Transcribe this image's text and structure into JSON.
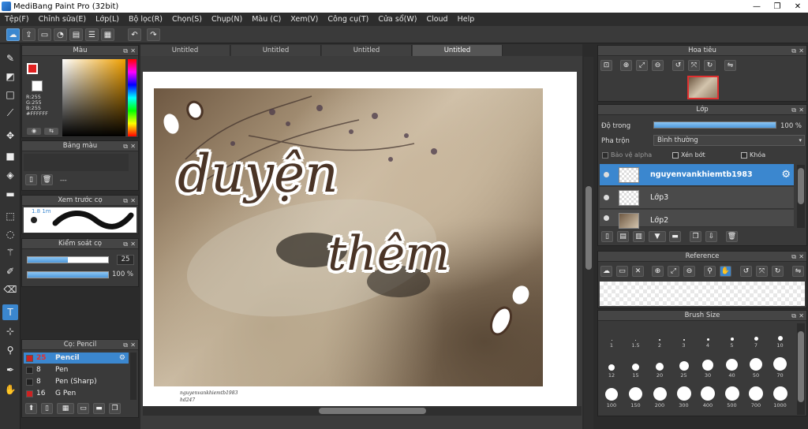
{
  "window": {
    "title": "MediBang Paint Pro (32bit)",
    "min": "—",
    "max": "❐",
    "close": "✕"
  },
  "menu": [
    "Tệp(F)",
    "Chỉnh sửa(E)",
    "Lớp(L)",
    "Bộ lọc(R)",
    "Chọn(S)",
    "Chụp(N)",
    "Màu (C)",
    "Xem(V)",
    "Công cụ(T)",
    "Cửa sổ(W)",
    "Cloud",
    "Help"
  ],
  "tabs": [
    "Untitled",
    "Untitled",
    "Untitled",
    "Untitled"
  ],
  "color_panel": {
    "title": "Màu",
    "r": "R:255",
    "g": "G:255",
    "b": "B:255",
    "hex": "#FFFFFF",
    "primary": "#e02020",
    "secondary": "#ffffff"
  },
  "palette_panel": {
    "title": "Bảng màu",
    "placeholder": "---"
  },
  "brush_preview": {
    "title": "Xem trước cọ",
    "size": "1.8 1m"
  },
  "brush_control": {
    "title": "Kiểm soát cọ",
    "size_value": "25",
    "size_fraction": 0.5,
    "opacity_value": "100 %",
    "opacity_fraction": 1.0
  },
  "brush_list": {
    "title": "Cọ: Pencil",
    "items": [
      {
        "size": "25",
        "name": "Pencil",
        "color": "#cc2222",
        "selected": true
      },
      {
        "size": "8",
        "name": "Pen",
        "color": "#222222",
        "selected": false
      },
      {
        "size": "8",
        "name": "Pen (Sharp)",
        "color": "#222222",
        "selected": false
      },
      {
        "size": "16",
        "name": "G Pen",
        "color": "#cc2222",
        "selected": false
      }
    ]
  },
  "canvas": {
    "line1": "duyện",
    "line2": "thêm",
    "signature1": "nguyenvankhiemtb1983",
    "signature2": "hd247"
  },
  "navigator": {
    "title": "Hoa tiêu"
  },
  "layer_panel": {
    "title": "Lớp",
    "opacity_label": "Độ trong",
    "opacity_value": "100 %",
    "opacity_fraction": 1.0,
    "blend_label": "Pha trộn",
    "blend_value": "Bình thường",
    "protect_alpha": "Bảo vệ alpha",
    "clipping": "Xén bớt",
    "lock": "Khóa",
    "layers": [
      {
        "name": "nguyenvankhiemtb1983",
        "selected": true
      },
      {
        "name": "Lớp3",
        "selected": false
      },
      {
        "name": "Lớp2",
        "selected": false
      }
    ]
  },
  "reference_panel": {
    "title": "Reference"
  },
  "brush_size_panel": {
    "title": "Brush Size",
    "sizes": [
      "1",
      "1.5",
      "2",
      "3",
      "4",
      "5",
      "7",
      "10",
      "12",
      "15",
      "20",
      "25",
      "30",
      "40",
      "50",
      "70",
      "100",
      "150",
      "200",
      "300",
      "400",
      "500",
      "700",
      "1000"
    ]
  }
}
